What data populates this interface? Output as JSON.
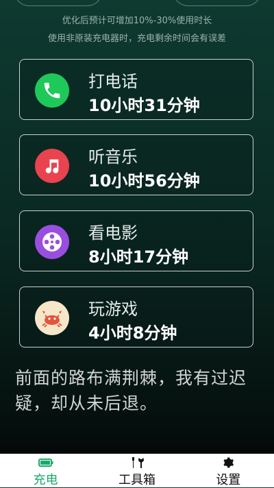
{
  "notes": {
    "line1": "优化后预计可增加10%-30%使用时长",
    "line2": "使用非原装充电器时，充电剩余时间会有误差"
  },
  "usage": [
    {
      "name": "打电话",
      "time": "10小时31分钟",
      "icon": "phone-icon",
      "color": "#1ec95a"
    },
    {
      "name": "听音乐",
      "time": "10小时56分钟",
      "icon": "music-note-icon",
      "color": "#e8434f"
    },
    {
      "name": "看电影",
      "time": "8小时17分钟",
      "icon": "film-reel-icon",
      "color": "#9a4ee0"
    },
    {
      "name": "玩游戏",
      "time": "4小时8分钟",
      "icon": "crab-icon",
      "color": "#f6e7c8"
    }
  ],
  "quote": "前面的路布满荆棘，我有过迟疑，却从未后退。",
  "tabs": [
    {
      "label": "充电",
      "icon": "battery-icon",
      "active": true
    },
    {
      "label": "工具箱",
      "icon": "tools-icon",
      "active": false
    },
    {
      "label": "设置",
      "icon": "gear-icon",
      "active": false
    }
  ],
  "colors": {
    "accent": "#1aa86c"
  }
}
